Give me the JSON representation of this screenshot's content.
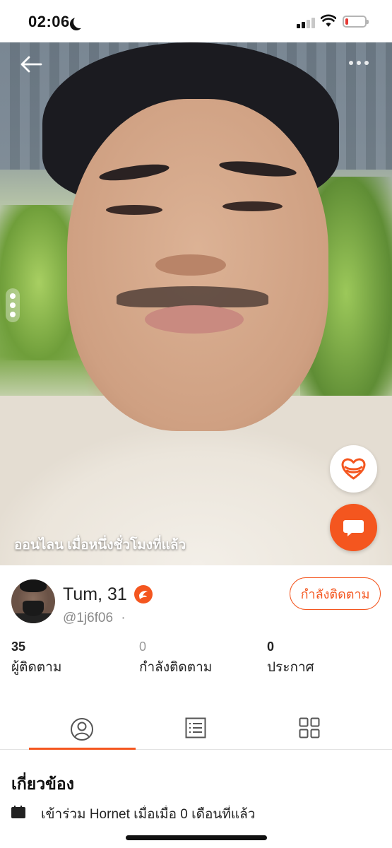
{
  "status_bar": {
    "time": "02:06",
    "battery_level": 0.15,
    "battery_color": "#e53935"
  },
  "photo": {
    "online_status": "ออนไลน เมื่อหนึ่งชั่วโมงที่แล้ว",
    "icons": [
      "back-arrow-icon",
      "more-icon",
      "heart-hands-icon",
      "chat-bubble-icon"
    ]
  },
  "profile": {
    "name": "Tum, 31",
    "username": "@1j6f06",
    "username_suffix": "·",
    "follow_button": "กำลังติดตาม"
  },
  "stats": [
    {
      "value": "35",
      "label": "ผู้ติดตาม"
    },
    {
      "value": "0",
      "label": "กำลังติดตาม"
    },
    {
      "value": "0",
      "label": "ประกาศ"
    }
  ],
  "tabs": [
    {
      "icon": "profile-icon",
      "active": true
    },
    {
      "icon": "list-icon",
      "active": false
    },
    {
      "icon": "grid-icon",
      "active": false
    }
  ],
  "about": {
    "title": "เกี่ยวข้อง",
    "joined": "เข้าร่วม Hornet เมื่อเมื่อ 0 เดือนที่แล้ว"
  },
  "colors": {
    "accent": "#f4561f"
  }
}
